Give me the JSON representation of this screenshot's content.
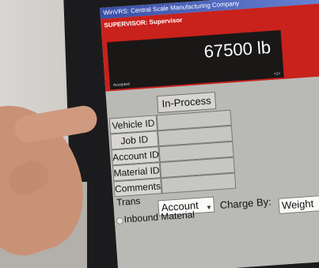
{
  "window": {
    "title": "WinVRS: Central Scale Manufacturing Company"
  },
  "header": {
    "supervisor_label": "SUPERVISOR: Supervisor",
    "weight": "67500 lb",
    "status_left": "Accepted",
    "status_right": "<1>"
  },
  "form": {
    "process_button": "In-Process",
    "vehicle_id_label": "Vehicle ID",
    "job_id_label": "Job ID",
    "account_id_label": "Account ID",
    "material_id_label": "Material ID",
    "comments_label": "Comments",
    "trans_label": "Trans",
    "account_select_value": "Account",
    "charge_by_label": "Charge By:",
    "charge_by_value": "Weight",
    "inbound_material_label": "Inbound Material"
  },
  "colors": {
    "title_bar": "#3b4fa8",
    "header_band": "#c9211c",
    "weight_display": "#1a1717",
    "form_background": "#b9bab6"
  }
}
